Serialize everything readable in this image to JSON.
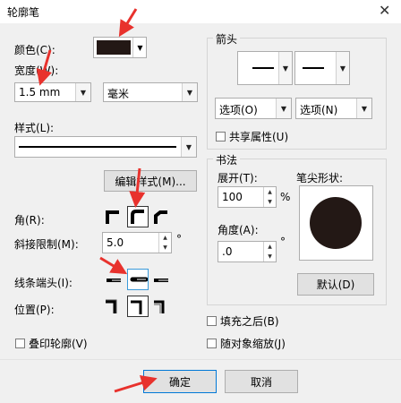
{
  "dialog": {
    "title": "轮廓笔",
    "close_glyph": "✕"
  },
  "color": {
    "label": "颜色(C):",
    "value": "#231815"
  },
  "width": {
    "label": "宽度(W):",
    "value": "1.5 mm",
    "unit": "毫米"
  },
  "style": {
    "label": "样式(L):",
    "edit_button": "编辑样式(M)..."
  },
  "corner": {
    "label": "角(R):"
  },
  "miter": {
    "label": "斜接限制(M):",
    "value": "5.0",
    "unit": "°"
  },
  "linecap": {
    "label": "线条端头(I):"
  },
  "position": {
    "label": "位置(P):"
  },
  "overprint": {
    "label": "叠印轮廓(V)"
  },
  "arrows": {
    "group_label": "箭头",
    "options_left": "选项(O)",
    "options_right": "选项(N)",
    "share_attr": "共享属性(U)"
  },
  "calligraphy": {
    "group_label": "书法",
    "stretch_label": "展开(T):",
    "stretch_value": "100",
    "stretch_unit": "%",
    "angle_label": "角度(A):",
    "angle_value": ".0",
    "angle_unit": "°",
    "nib_label": "笔尖形状:",
    "default_button": "默认(D)",
    "nib_color": "#231815"
  },
  "behind_fill": {
    "label": "填充之后(B)"
  },
  "scale_with": {
    "label": "随对象缩放(J)"
  },
  "footer": {
    "ok": "确定",
    "cancel": "取消"
  },
  "accent": "#e8322d"
}
